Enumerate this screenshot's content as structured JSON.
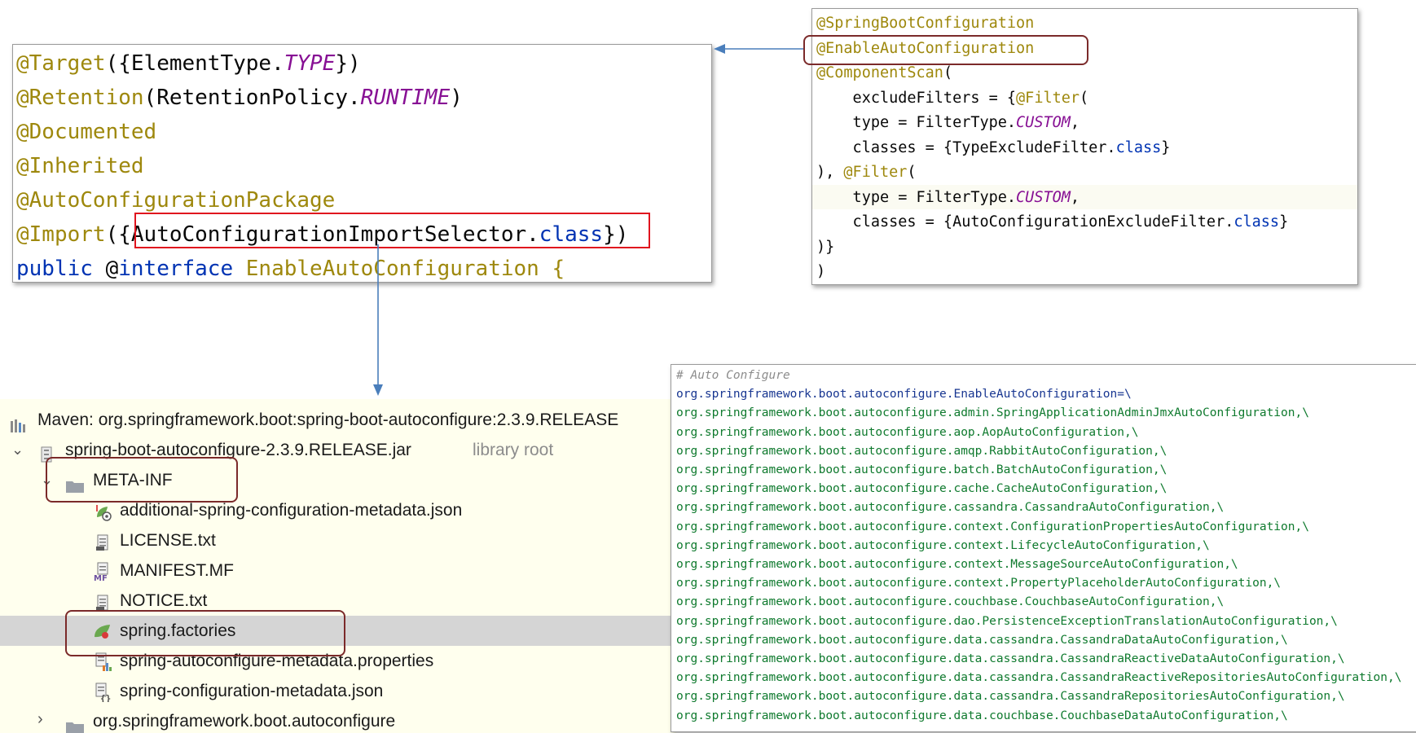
{
  "code_panel": {
    "lines": [
      {
        "ann": "@Target",
        "p1": "({ElementType.",
        "it": "TYPE",
        "p2": "})"
      },
      {
        "ann": "@Retention",
        "p1": "(RetentionPolicy.",
        "it": "RUNTIME",
        "p2": ")"
      },
      {
        "ann": "@Documented"
      },
      {
        "ann": "@Inherited"
      },
      {
        "ann": "@AutoConfigurationPackage"
      },
      {
        "ann": "@Import",
        "p1": "({",
        "sel": "AutoConfigurationImportSelector.",
        "selkw": "class",
        "p2": "})"
      },
      {
        "kw1": "public",
        "sp": " @",
        "kw2": "interface",
        "tail": " EnableAutoConfiguration {"
      }
    ]
  },
  "boot_panel": {
    "l1": "@SpringBootConfiguration",
    "l2": "@EnableAutoConfiguration",
    "l3a": "@ComponentScan",
    "l3b": "(",
    "l4a": "    excludeFilters = {",
    "l4b": "@Filter",
    "l4c": "(",
    "l5a": "    type = FilterType.",
    "l5b": "CUSTOM",
    "l5c": ",",
    "l6a": "    classes = {TypeExcludeFilter.",
    "l6b": "class",
    "l6c": "}",
    "l7a": "), ",
    "l7b": "@Filter",
    "l7c": "(",
    "l8a": "    type = FilterType.",
    "l8b": "CUSTOM",
    "l8c": ",",
    "l9a": "    classes = {AutoConfigurationExcludeFilter.",
    "l9b": "class",
    "l9c": "}",
    "l10": ")}",
    "l11": ")"
  },
  "project_tree": {
    "maven": "Maven: org.springframework.boot:spring-boot-autoconfigure:2.3.9.RELEASE",
    "jar": "spring-boot-autoconfigure-2.3.9.RELEASE.jar",
    "jar_hint": "library root",
    "meta_inf": "META-INF",
    "files": [
      "additional-spring-configuration-metadata.json",
      "LICENSE.txt",
      "MANIFEST.MF",
      "NOTICE.txt",
      "spring.factories",
      "spring-autoconfigure-metadata.properties",
      "spring-configuration-metadata.json"
    ],
    "package": "org.springframework.boot.autoconfigure"
  },
  "factories": {
    "comment": "# Auto Configure",
    "key": "org.springframework.boot.autoconfigure.EnableAutoConfiguration=\\",
    "entries": [
      "org.springframework.boot.autoconfigure.admin.SpringApplicationAdminJmxAutoConfiguration,\\",
      "org.springframework.boot.autoconfigure.aop.AopAutoConfiguration,\\",
      "org.springframework.boot.autoconfigure.amqp.RabbitAutoConfiguration,\\",
      "org.springframework.boot.autoconfigure.batch.BatchAutoConfiguration,\\",
      "org.springframework.boot.autoconfigure.cache.CacheAutoConfiguration,\\",
      "org.springframework.boot.autoconfigure.cassandra.CassandraAutoConfiguration,\\",
      "org.springframework.boot.autoconfigure.context.ConfigurationPropertiesAutoConfiguration,\\",
      "org.springframework.boot.autoconfigure.context.LifecycleAutoConfiguration,\\",
      "org.springframework.boot.autoconfigure.context.MessageSourceAutoConfiguration,\\",
      "org.springframework.boot.autoconfigure.context.PropertyPlaceholderAutoConfiguration,\\",
      "org.springframework.boot.autoconfigure.couchbase.CouchbaseAutoConfiguration,\\",
      "org.springframework.boot.autoconfigure.dao.PersistenceExceptionTranslationAutoConfiguration,\\",
      "org.springframework.boot.autoconfigure.data.cassandra.CassandraDataAutoConfiguration,\\",
      "org.springframework.boot.autoconfigure.data.cassandra.CassandraReactiveDataAutoConfiguration,\\",
      "org.springframework.boot.autoconfigure.data.cassandra.CassandraReactiveRepositoriesAutoConfiguration,\\",
      "org.springframework.boot.autoconfigure.data.cassandra.CassandraRepositoriesAutoConfiguration,\\",
      "org.springframework.boot.autoconfigure.data.couchbase.CouchbaseDataAutoConfiguration,\\"
    ]
  },
  "colors": {
    "annotation": "#9e880d",
    "keyword": "#0033b3",
    "constant": "#871094",
    "highlight_box": "#7b2a2a",
    "selection_box": "#e0141e",
    "arrow": "#4a7ebb",
    "props_value": "#0f7a2e"
  }
}
